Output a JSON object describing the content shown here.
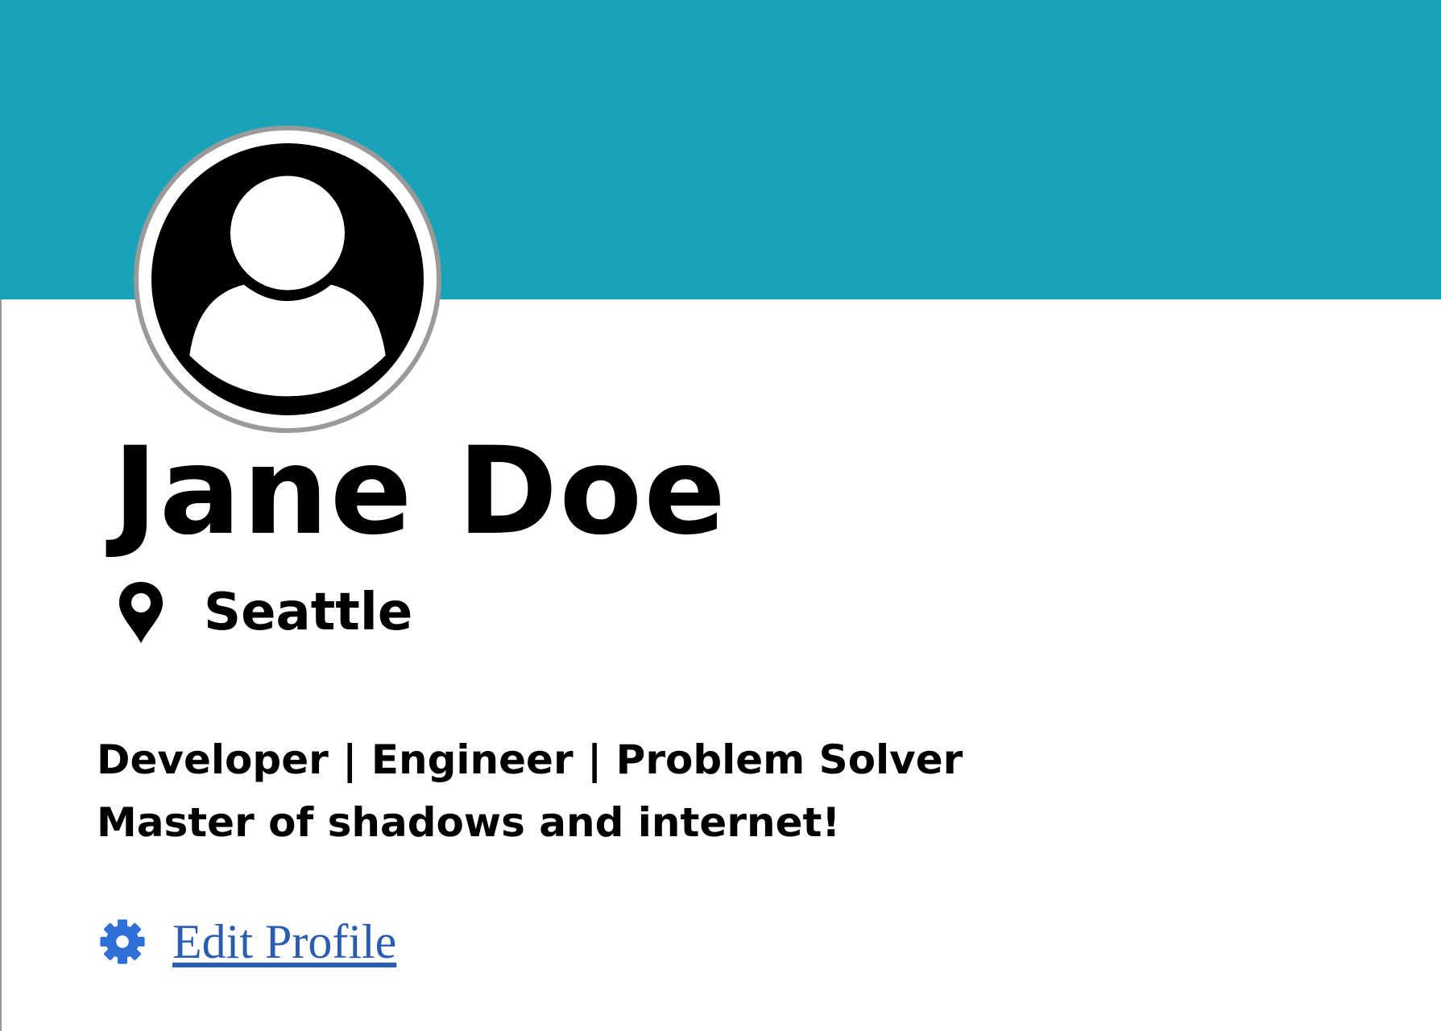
{
  "profile": {
    "name": "Jane Doe",
    "location": "Seattle",
    "bio_lines": [
      "Developer | Engineer | Problem Solver",
      "Master of shadows and internet!"
    ],
    "edit_label": "Edit Profile"
  },
  "icons": {
    "avatar": "user-avatar-icon",
    "location": "map-pin-icon",
    "edit": "gear-icon"
  },
  "colors": {
    "banner": "#19a3b8",
    "link": "#2a5db0",
    "gear": "#2f6fd6",
    "avatar_border": "#9a9a9a"
  }
}
